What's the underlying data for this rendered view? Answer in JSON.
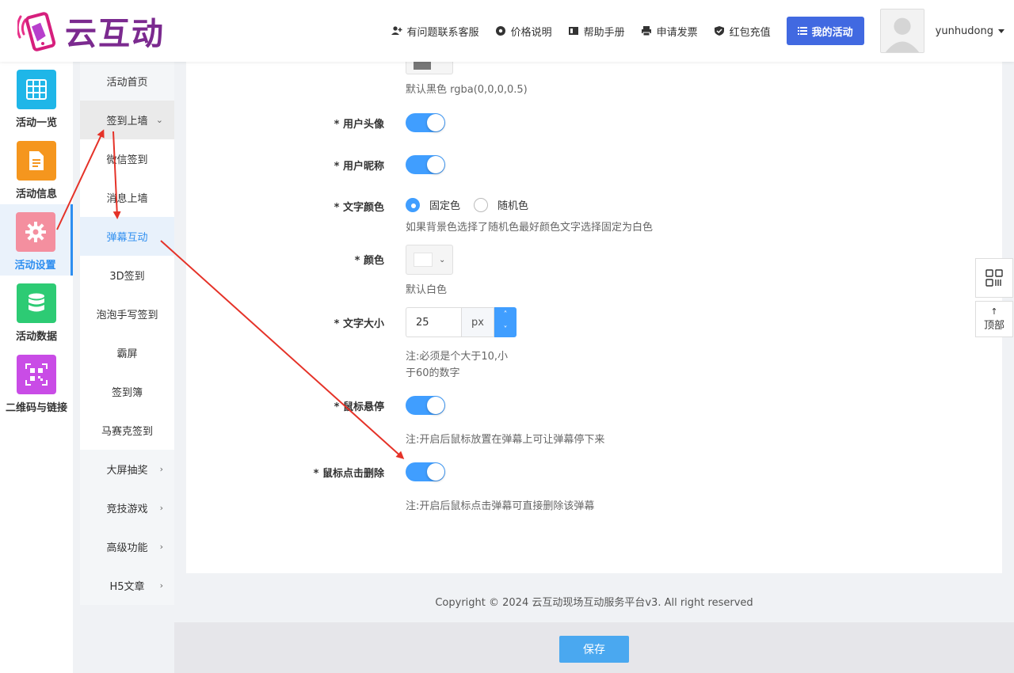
{
  "header": {
    "logo_text": "云互动",
    "nav": [
      {
        "label": "有问题联系客服",
        "icon": "user-plus-icon"
      },
      {
        "label": "价格说明",
        "icon": "gear-icon"
      },
      {
        "label": "帮助手册",
        "icon": "book-icon"
      },
      {
        "label": "申请发票",
        "icon": "printer-icon"
      },
      {
        "label": "红包充值",
        "icon": "shield-check-icon"
      }
    ],
    "my_activity": "我的活动",
    "username": "yunhudong"
  },
  "sidebar": {
    "items": [
      {
        "label": "活动一览",
        "icon": "grid-icon",
        "color": "#1fb6e8"
      },
      {
        "label": "活动信息",
        "icon": "document-icon",
        "color": "#f5961e"
      },
      {
        "label": "活动设置",
        "icon": "gear-icon",
        "color": "#f48f9f"
      },
      {
        "label": "活动数据",
        "icon": "database-icon",
        "color": "#2dcb74"
      },
      {
        "label": "二维码与链接",
        "icon": "qrcode-icon",
        "color": "#c94ce6"
      }
    ]
  },
  "submenu": {
    "items": [
      "活动首页",
      "签到上墙",
      "微信签到",
      "消息上墙",
      "弹幕互动",
      "3D签到",
      "泡泡手写签到",
      "霸屏",
      "签到簿",
      "马赛克签到",
      "大屏抽奖",
      "竞技游戏",
      "高级功能",
      "H5文章"
    ]
  },
  "form": {
    "bg_hint": "默认黑色 rgba(0,0,0,0.5)",
    "avatar_label": "* 用户头像",
    "nickname_label": "* 用户昵称",
    "text_color_label": "* 文字颜色",
    "radio_fixed": "固定色",
    "radio_random": "随机色",
    "text_color_hint": "如果背景色选择了随机色最好颜色文字选择固定为白色",
    "color_label": "* 颜色",
    "color_hint": "默认白色",
    "font_size_label": "* 文字大小",
    "font_size_value": "25",
    "font_size_unit": "px",
    "font_size_hint_1": "注:必须是个大于10,小",
    "font_size_hint_2": "于60的数字",
    "hover_label": "* 鼠标悬停",
    "hover_hint": "注:开启后鼠标放置在弹幕上可让弹幕停下来",
    "click_delete_label": "* 鼠标点击删除",
    "click_delete_hint": "注:开启后鼠标点击弹幕可直接删除该弹幕"
  },
  "footer": {
    "copyright": "Copyright © 2024 云互动现场互动服务平台v3. All right reserved",
    "save": "保存"
  },
  "floating": {
    "top_label": "顶部"
  },
  "colors": {
    "primary": "#409eff",
    "nav_button": "#4169e1",
    "annotation": "#e53228"
  }
}
